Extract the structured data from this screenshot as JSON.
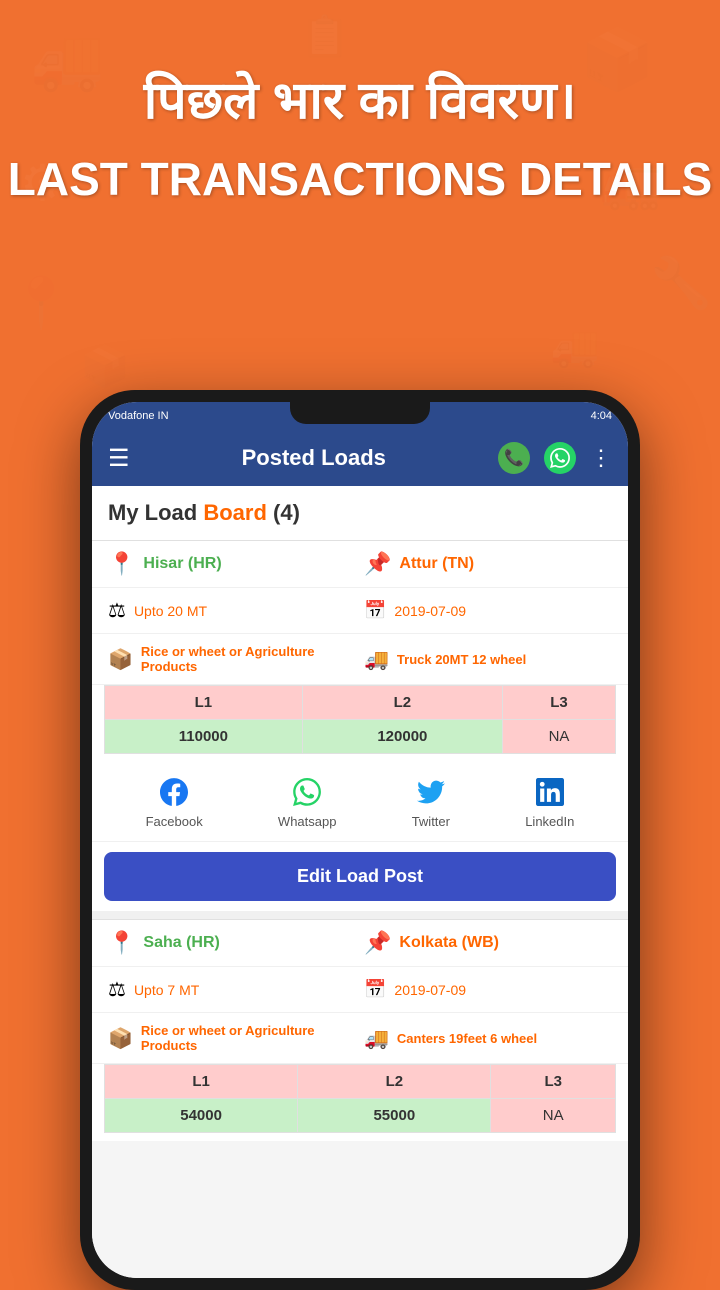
{
  "page": {
    "background_color": "#F07030"
  },
  "header": {
    "hindi_title": "पिछले भार का विवरण।",
    "english_subtitle": "LAST TRANSACTIONS DETAILS"
  },
  "app_bar": {
    "title": "Posted Loads",
    "menu_icon": "☰",
    "more_icon": "⋮"
  },
  "load_board": {
    "title_prefix": "My Load Board ",
    "title_highlight": "Board",
    "count": "(4)"
  },
  "cards": [
    {
      "id": "card1",
      "origin": "Hisar (HR)",
      "destination": "Attur (TN)",
      "weight": "Upto 20 MT",
      "date": "2019-07-09",
      "cargo": "Rice or wheet or Agriculture Products",
      "truck": "Truck 20MT  12 wheel",
      "prices": {
        "headers": [
          "L1",
          "L2",
          "L3"
        ],
        "values": [
          "110000",
          "120000",
          "NA"
        ]
      },
      "social": [
        "Facebook",
        "Whatsapp",
        "Twitter",
        "LinkedIn"
      ],
      "edit_button": "Edit Load Post"
    },
    {
      "id": "card2",
      "origin": "Saha (HR)",
      "destination": "Kolkata (WB)",
      "weight": "Upto 7 MT",
      "date": "2019-07-09",
      "cargo": "Rice or wheet or Agriculture Products",
      "truck": "Canters 19feet  6 wheel",
      "prices": {
        "headers": [
          "L1",
          "L2",
          "L3"
        ],
        "values": [
          "54000",
          "55000",
          "NA"
        ]
      }
    }
  ],
  "status_bar": {
    "carrier": "Vodafone IN",
    "time": "4:04"
  }
}
